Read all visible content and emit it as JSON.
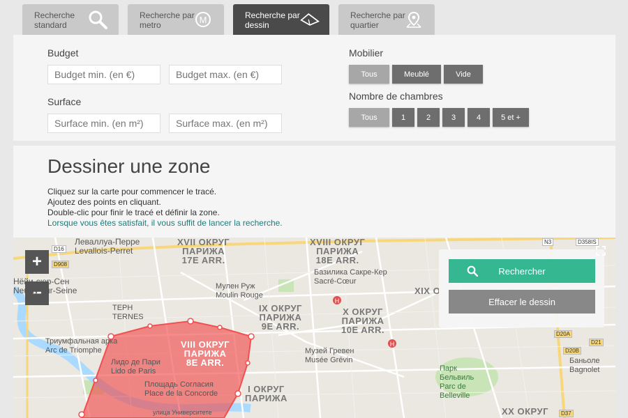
{
  "tabs": [
    {
      "label": "Recherche standard",
      "icon": "search-icon"
    },
    {
      "label": "Recherche par metro",
      "icon": "metro-icon"
    },
    {
      "label": "Recherche par dessin",
      "icon": "draw-icon"
    },
    {
      "label": "Recherche par quartier",
      "icon": "map-pin-icon"
    }
  ],
  "filters": {
    "budget_label": "Budget",
    "budget_min_placeholder": "Budget min. (en €)",
    "budget_max_placeholder": "Budget max. (en €)",
    "surface_label": "Surface",
    "surface_min_placeholder": "Surface min. (en m²)",
    "surface_max_placeholder": "Surface max. (en m²)",
    "mobilier_label": "Mobilier",
    "mobilier_options": [
      "Tous",
      "Meublé",
      "Vide"
    ],
    "chambres_label": "Nombre de chambres",
    "chambres_options": [
      "Tous",
      "1",
      "2",
      "3",
      "4",
      "5 et +"
    ]
  },
  "draw": {
    "title": "Dessiner une zone",
    "line1": "Cliquez sur la carte pour commencer le tracé.",
    "line2": "Ajoutez des points en cliquant.",
    "line3": "Double-clic pour finir le tracé et définir la zone.",
    "line4": "Lorsque vous êtes satisfait, il vous suffit de lancer la recherche."
  },
  "map": {
    "zoom_in": "+",
    "zoom_out": "−",
    "search_button": "Rechercher",
    "clear_button": "Effacer le dessin",
    "labels": {
      "levallois": "Леваллуа-Перре\nLevallois-Perret",
      "neuilly": "Нёйи-сюр-Сен\nNeuilly-sur-Seine",
      "xvii": "XVII ОКРУГ\nПАРИЖА\n17E ARR.",
      "xviii": "XVIII ОКРУГ\nПАРИЖА\n18E ARR.",
      "ix": "IX ОКРУГ\nПАРИЖА\n9E ARR.",
      "x": "X ОКРУГ\nПАРИЖА\n10E ARR.",
      "viii": "VIII ОКРУГ\nПАРИЖА\n8E ARR.",
      "i": "I ОКРУГ\nПАРИЖА",
      "xix": "XIX О",
      "xx": "XX ОКРУГ",
      "ternes": "ТЕРН\nTERNES",
      "moulin": "Мулен Руж\nMoulin Rouge",
      "sacre": "Базилика Сакре-Кер\nSacré-Cœur",
      "triomphe": "Триумфальная арка\nArc de Triomphe",
      "lido": "Лидо де Пари\nLido de Paris",
      "concorde": "Площадь Согласия\nPlace de la Concorde",
      "grevin": "Музей Гревен\nMusée Grévin",
      "belleville": "Парк\nБельвиль\nParc de\nBelleville",
      "bagnolet": "Баньоле\nBagnolet",
      "rue_univ": "улица Университете"
    },
    "roads": [
      "D16",
      "D908",
      "D358IS",
      "N3",
      "D20A",
      "D20B",
      "D21",
      "D37"
    ]
  },
  "colors": {
    "accent": "#35b891",
    "tab_active": "#4a4a4a",
    "polygon": "#f05050"
  }
}
